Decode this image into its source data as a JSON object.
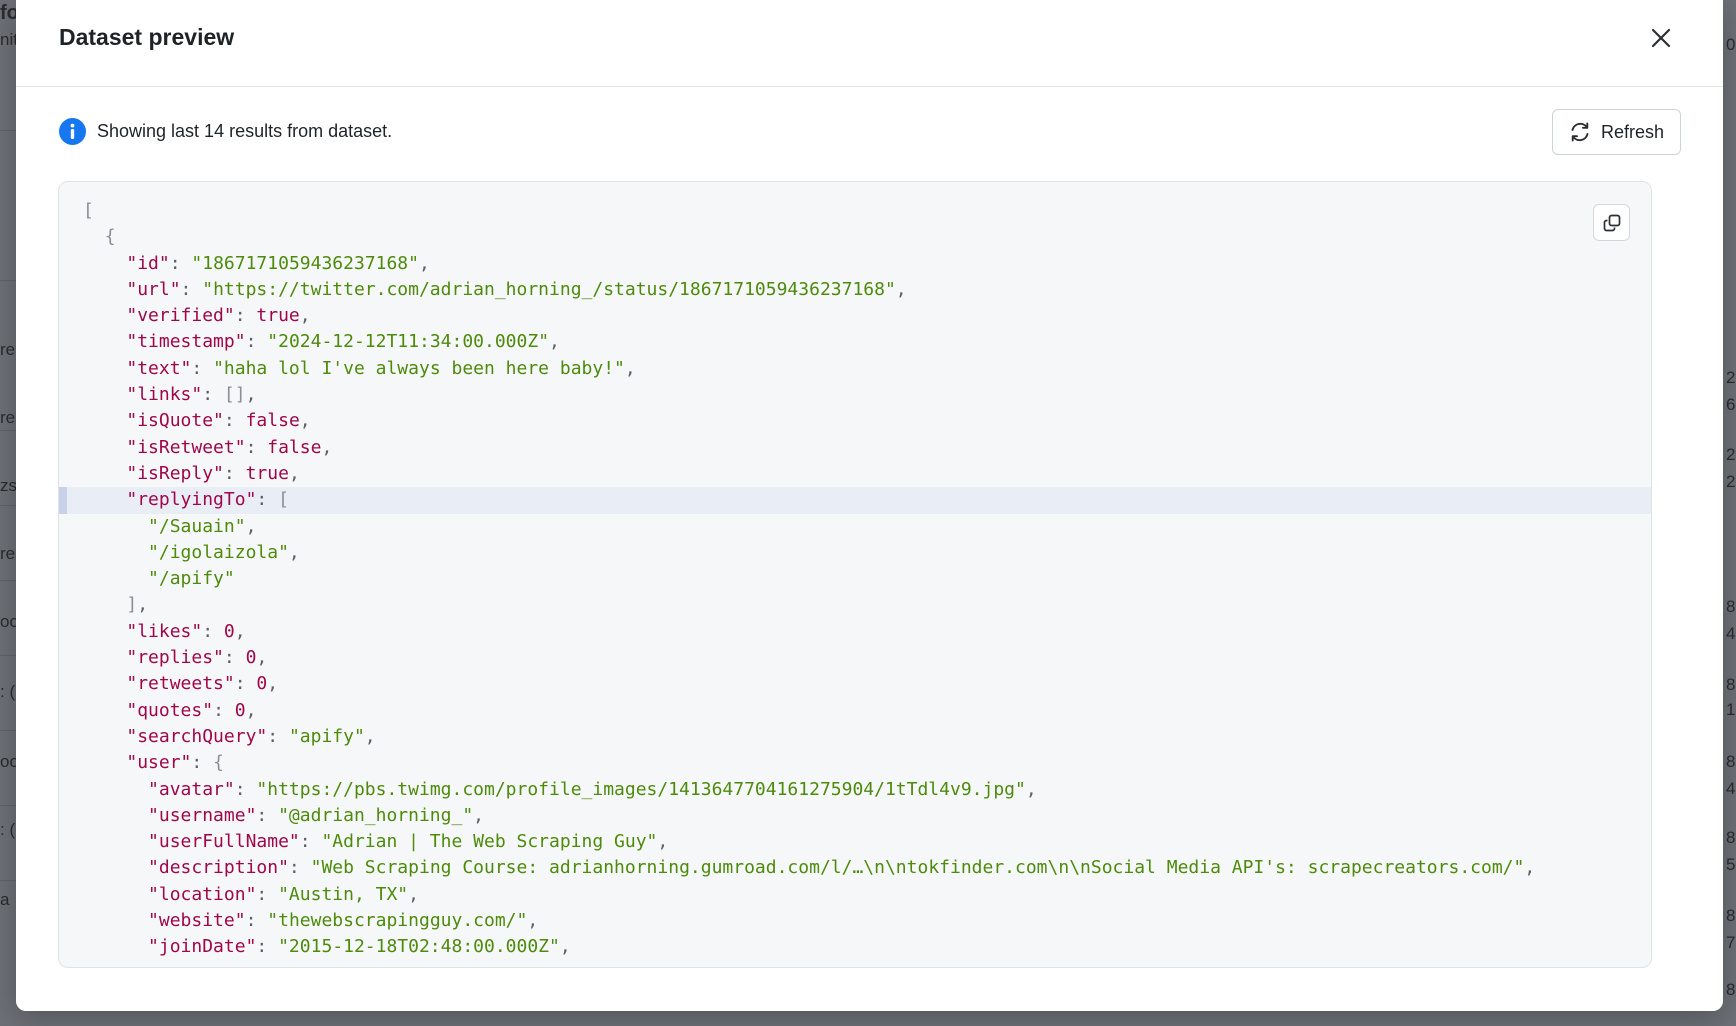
{
  "modal": {
    "title": "Dataset preview",
    "info_text": "Showing last 14 results from dataset.",
    "refresh_label": "Refresh"
  },
  "background": {
    "left_fragments": [
      "fo",
      "nit",
      "rea",
      "rea",
      "zs:",
      "rea",
      "oo",
      ": (",
      "oo",
      ": (",
      "a"
    ],
    "right_fragments": [
      "0",
      "2",
      "6",
      "2",
      "2",
      "8",
      "4",
      "8",
      "1",
      "8",
      "4",
      "8",
      "5",
      "8",
      "7",
      "8"
    ]
  },
  "code": {
    "lines": [
      {
        "indent": 0,
        "tokens": [
          {
            "t": "p",
            "v": "["
          }
        ]
      },
      {
        "indent": 1,
        "tokens": [
          {
            "t": "p",
            "v": "{"
          }
        ]
      },
      {
        "indent": 2,
        "tokens": [
          {
            "t": "k",
            "v": "\"id\""
          },
          {
            "t": "pc",
            "v": ": "
          },
          {
            "t": "s",
            "v": "\"1867171059436237168\""
          },
          {
            "t": "pc",
            "v": ","
          }
        ]
      },
      {
        "indent": 2,
        "tokens": [
          {
            "t": "k",
            "v": "\"url\""
          },
          {
            "t": "pc",
            "v": ": "
          },
          {
            "t": "s",
            "v": "\"https://twitter.com/adrian_horning_/status/1867171059436237168\""
          },
          {
            "t": "pc",
            "v": ","
          }
        ]
      },
      {
        "indent": 2,
        "tokens": [
          {
            "t": "k",
            "v": "\"verified\""
          },
          {
            "t": "pc",
            "v": ": "
          },
          {
            "t": "b",
            "v": "true"
          },
          {
            "t": "pc",
            "v": ","
          }
        ]
      },
      {
        "indent": 2,
        "tokens": [
          {
            "t": "k",
            "v": "\"timestamp\""
          },
          {
            "t": "pc",
            "v": ": "
          },
          {
            "t": "s",
            "v": "\"2024-12-12T11:34:00.000Z\""
          },
          {
            "t": "pc",
            "v": ","
          }
        ]
      },
      {
        "indent": 2,
        "tokens": [
          {
            "t": "k",
            "v": "\"text\""
          },
          {
            "t": "pc",
            "v": ": "
          },
          {
            "t": "s",
            "v": "\"haha lol I've always been here baby!\""
          },
          {
            "t": "pc",
            "v": ","
          }
        ]
      },
      {
        "indent": 2,
        "tokens": [
          {
            "t": "k",
            "v": "\"links\""
          },
          {
            "t": "pc",
            "v": ": "
          },
          {
            "t": "p",
            "v": "[]"
          },
          {
            "t": "pc",
            "v": ","
          }
        ]
      },
      {
        "indent": 2,
        "tokens": [
          {
            "t": "k",
            "v": "\"isQuote\""
          },
          {
            "t": "pc",
            "v": ": "
          },
          {
            "t": "b",
            "v": "false"
          },
          {
            "t": "pc",
            "v": ","
          }
        ]
      },
      {
        "indent": 2,
        "tokens": [
          {
            "t": "k",
            "v": "\"isRetweet\""
          },
          {
            "t": "pc",
            "v": ": "
          },
          {
            "t": "b",
            "v": "false"
          },
          {
            "t": "pc",
            "v": ","
          }
        ]
      },
      {
        "indent": 2,
        "tokens": [
          {
            "t": "k",
            "v": "\"isReply\""
          },
          {
            "t": "pc",
            "v": ": "
          },
          {
            "t": "b",
            "v": "true"
          },
          {
            "t": "pc",
            "v": ","
          }
        ]
      },
      {
        "indent": 2,
        "hl": true,
        "tokens": [
          {
            "t": "k",
            "v": "\"replyingTo\""
          },
          {
            "t": "pc",
            "v": ": "
          },
          {
            "t": "p",
            "v": "["
          }
        ]
      },
      {
        "indent": 3,
        "tokens": [
          {
            "t": "s",
            "v": "\"/Sauain\""
          },
          {
            "t": "pc",
            "v": ","
          }
        ]
      },
      {
        "indent": 3,
        "tokens": [
          {
            "t": "s",
            "v": "\"/igolaizola\""
          },
          {
            "t": "pc",
            "v": ","
          }
        ]
      },
      {
        "indent": 3,
        "tokens": [
          {
            "t": "s",
            "v": "\"/apify\""
          }
        ]
      },
      {
        "indent": 2,
        "tokens": [
          {
            "t": "p",
            "v": "]"
          },
          {
            "t": "pc",
            "v": ","
          }
        ]
      },
      {
        "indent": 2,
        "tokens": [
          {
            "t": "k",
            "v": "\"likes\""
          },
          {
            "t": "pc",
            "v": ": "
          },
          {
            "t": "n",
            "v": "0"
          },
          {
            "t": "pc",
            "v": ","
          }
        ]
      },
      {
        "indent": 2,
        "tokens": [
          {
            "t": "k",
            "v": "\"replies\""
          },
          {
            "t": "pc",
            "v": ": "
          },
          {
            "t": "n",
            "v": "0"
          },
          {
            "t": "pc",
            "v": ","
          }
        ]
      },
      {
        "indent": 2,
        "tokens": [
          {
            "t": "k",
            "v": "\"retweets\""
          },
          {
            "t": "pc",
            "v": ": "
          },
          {
            "t": "n",
            "v": "0"
          },
          {
            "t": "pc",
            "v": ","
          }
        ]
      },
      {
        "indent": 2,
        "tokens": [
          {
            "t": "k",
            "v": "\"quotes\""
          },
          {
            "t": "pc",
            "v": ": "
          },
          {
            "t": "n",
            "v": "0"
          },
          {
            "t": "pc",
            "v": ","
          }
        ]
      },
      {
        "indent": 2,
        "tokens": [
          {
            "t": "k",
            "v": "\"searchQuery\""
          },
          {
            "t": "pc",
            "v": ": "
          },
          {
            "t": "s",
            "v": "\"apify\""
          },
          {
            "t": "pc",
            "v": ","
          }
        ]
      },
      {
        "indent": 2,
        "tokens": [
          {
            "t": "k",
            "v": "\"user\""
          },
          {
            "t": "pc",
            "v": ": "
          },
          {
            "t": "p",
            "v": "{"
          }
        ]
      },
      {
        "indent": 3,
        "tokens": [
          {
            "t": "k",
            "v": "\"avatar\""
          },
          {
            "t": "pc",
            "v": ": "
          },
          {
            "t": "s",
            "v": "\"https://pbs.twimg.com/profile_images/1413647704161275904/1tTdl4v9.jpg\""
          },
          {
            "t": "pc",
            "v": ","
          }
        ]
      },
      {
        "indent": 3,
        "tokens": [
          {
            "t": "k",
            "v": "\"username\""
          },
          {
            "t": "pc",
            "v": ": "
          },
          {
            "t": "s",
            "v": "\"@adrian_horning_\""
          },
          {
            "t": "pc",
            "v": ","
          }
        ]
      },
      {
        "indent": 3,
        "tokens": [
          {
            "t": "k",
            "v": "\"userFullName\""
          },
          {
            "t": "pc",
            "v": ": "
          },
          {
            "t": "s",
            "v": "\"Adrian | The Web Scraping Guy\""
          },
          {
            "t": "pc",
            "v": ","
          }
        ]
      },
      {
        "indent": 3,
        "tokens": [
          {
            "t": "k",
            "v": "\"description\""
          },
          {
            "t": "pc",
            "v": ": "
          },
          {
            "t": "s",
            "v": "\"Web Scraping Course: adrianhorning.gumroad.com/l/…\\n\\ntokfinder.com\\n\\nSocial Media API's: scrapecreators.com/\""
          },
          {
            "t": "pc",
            "v": ","
          }
        ]
      },
      {
        "indent": 3,
        "tokens": [
          {
            "t": "k",
            "v": "\"location\""
          },
          {
            "t": "pc",
            "v": ": "
          },
          {
            "t": "s",
            "v": "\"Austin, TX\""
          },
          {
            "t": "pc",
            "v": ","
          }
        ]
      },
      {
        "indent": 3,
        "tokens": [
          {
            "t": "k",
            "v": "\"website\""
          },
          {
            "t": "pc",
            "v": ": "
          },
          {
            "t": "s",
            "v": "\"thewebscrapingguy.com/\""
          },
          {
            "t": "pc",
            "v": ","
          }
        ]
      },
      {
        "indent": 3,
        "tokens": [
          {
            "t": "k",
            "v": "\"joinDate\""
          },
          {
            "t": "pc",
            "v": ": "
          },
          {
            "t": "s",
            "v": "\"2015-12-18T02:48:00.000Z\""
          },
          {
            "t": "pc",
            "v": ","
          }
        ]
      }
    ]
  },
  "colors": {
    "key": "#a0074a",
    "string": "#4d8b0a",
    "info_accent": "#1677f0"
  }
}
